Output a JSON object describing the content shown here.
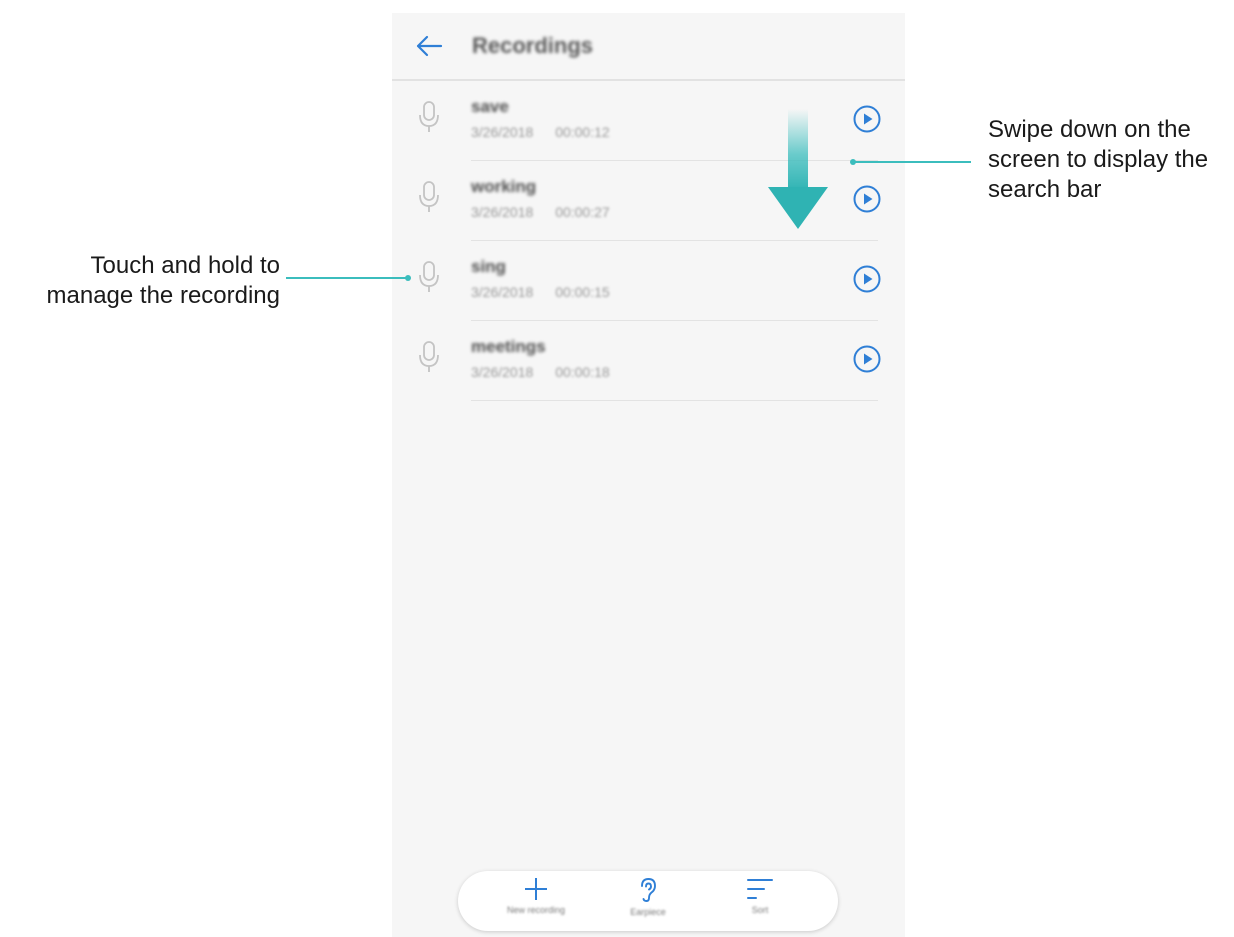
{
  "header": {
    "title": "Recordings"
  },
  "recordings": [
    {
      "name": "save",
      "date": "3/26/2018",
      "duration": "00:00:12"
    },
    {
      "name": "working",
      "date": "3/26/2018",
      "duration": "00:00:27"
    },
    {
      "name": "sing",
      "date": "3/26/2018",
      "duration": "00:00:15"
    },
    {
      "name": "meetings",
      "date": "3/26/2018",
      "duration": "00:00:18"
    }
  ],
  "toolbar": {
    "items": [
      {
        "label": "New recording",
        "icon": "plus-icon"
      },
      {
        "label": "Earpiece",
        "icon": "ear-icon"
      },
      {
        "label": "Sort",
        "icon": "sort-icon"
      }
    ]
  },
  "callouts": {
    "left": "Touch and hold to manage the recording",
    "right": "Swipe down on the screen to display the search bar"
  },
  "colors": {
    "accent": "#2f7fd6",
    "callout_line": "#3bbdbd",
    "screen_bg": "#f6f6f6",
    "mic_gray": "#c4c4c4"
  }
}
